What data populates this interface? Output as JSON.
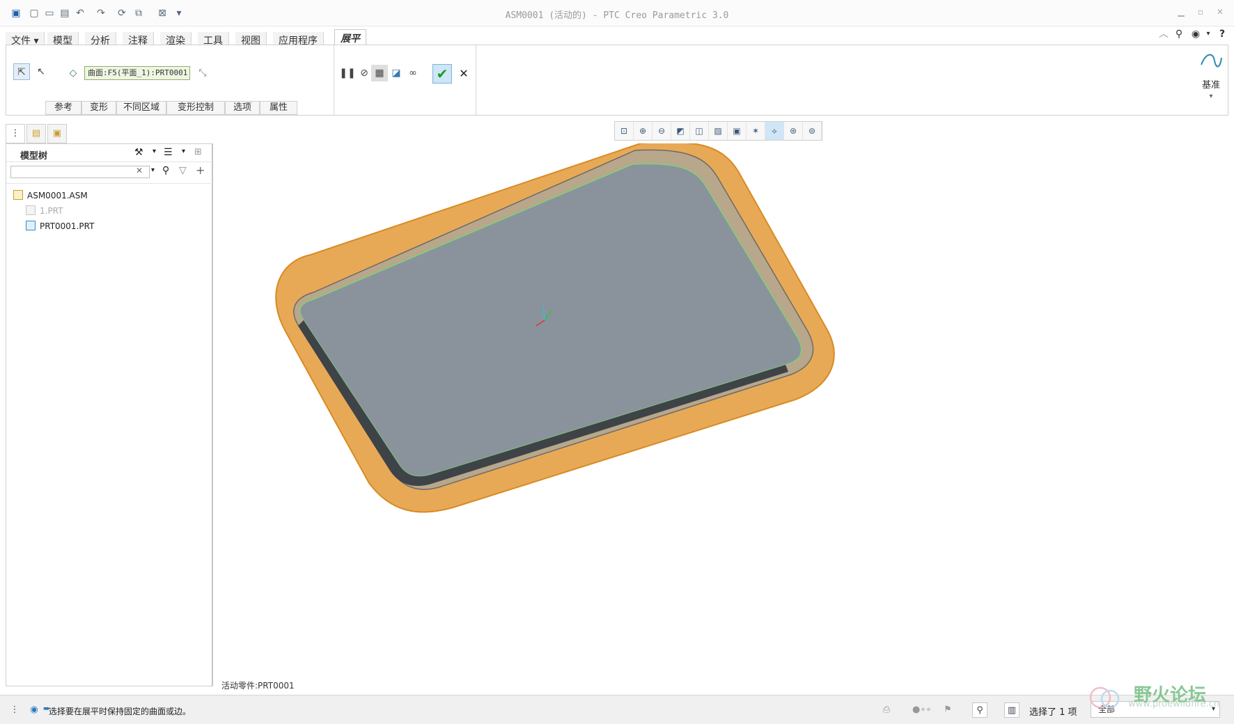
{
  "window": {
    "title": "ASM0001 (活动的) - PTC Creo Parametric 3.0"
  },
  "ribbon": {
    "tabs": [
      "文件",
      "模型",
      "分析",
      "注释",
      "渲染",
      "工具",
      "视图",
      "应用程序",
      "展平"
    ],
    "active_tab": "展平",
    "reference_field": "曲面:F5(平面_1):PRT0001",
    "subtabs": [
      "参考",
      "变形",
      "不同区域",
      "变形控制",
      "选项",
      "属性"
    ],
    "datum_label": "基准"
  },
  "model_tree": {
    "title": "模型树",
    "search_value": "",
    "items": [
      {
        "label": "ASM0001.ASM",
        "state": "normal"
      },
      {
        "label": "1.PRT",
        "state": "suppressed"
      },
      {
        "label": "PRT0001.PRT",
        "state": "normal"
      }
    ]
  },
  "graphics": {
    "active_part_label": "活动零件:PRT0001"
  },
  "statusbar": {
    "message": "选择要在展平时保持固定的曲面或边。",
    "selection": "选择了 1 项",
    "filter": "全部"
  },
  "watermark": {
    "text": "野火论坛",
    "sub": "www.proewildfire.cn"
  },
  "colors": {
    "surface_orange": "#e49a3a",
    "surface_gray": "#8a939b",
    "accent_blue": "#cfe6f6"
  }
}
